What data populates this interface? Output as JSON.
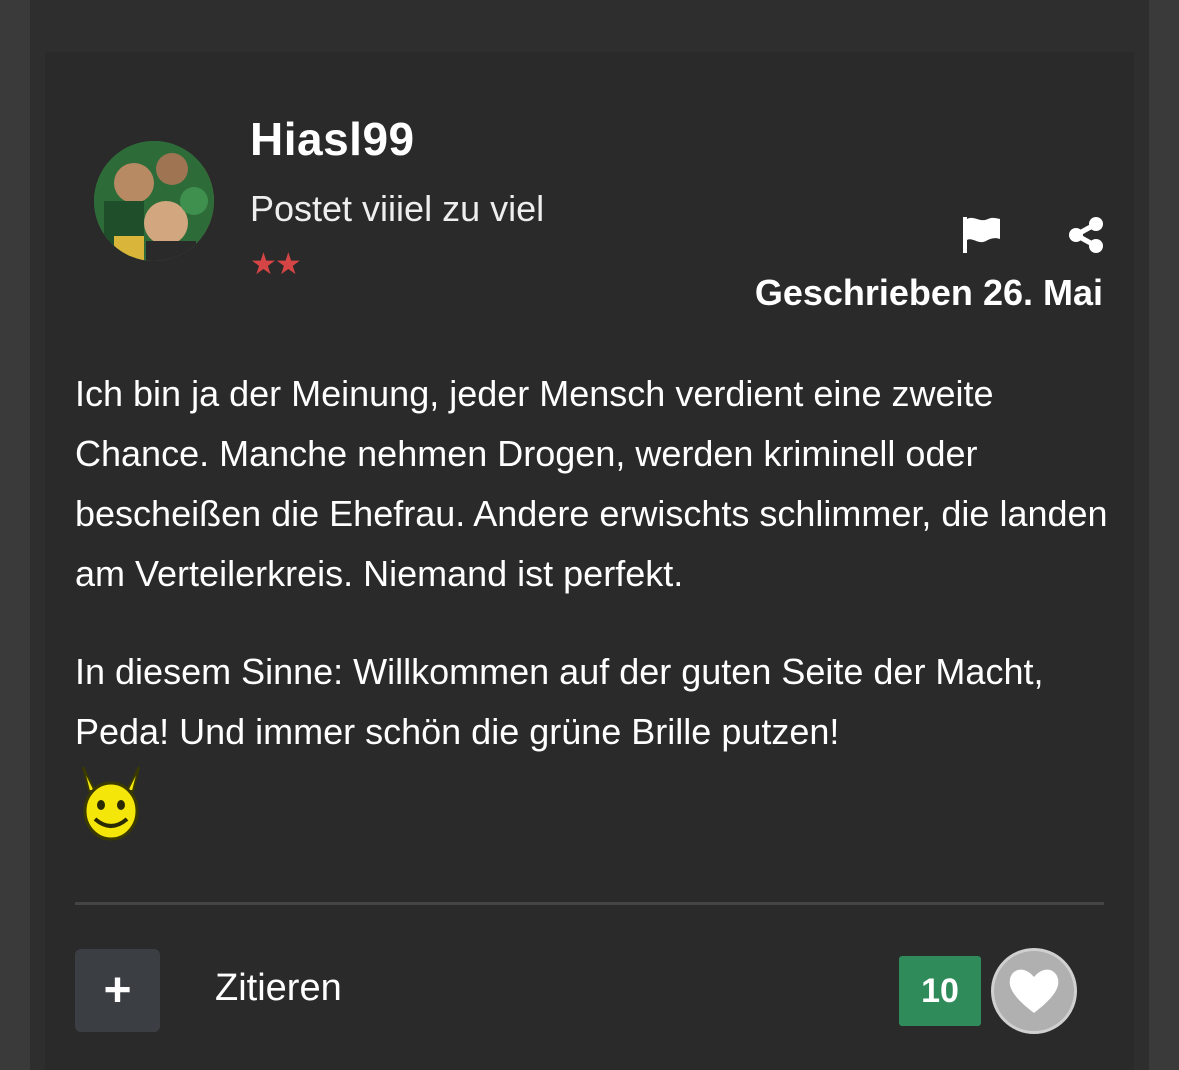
{
  "author": {
    "name": "Hiasl99",
    "title": "Postet viiiel zu viel",
    "rank_stars": "★★"
  },
  "post": {
    "date_prefix": "Geschrieben",
    "date": "26. Mai",
    "paragraphs": [
      "Ich bin ja der Meinung, jeder Mensch verdient eine zweite Chance. Manche nehmen Drogen, werden kriminell oder bescheißen die Ehefrau. Andere erwischts schlimmer, die landen am Verteilerkreis. Niemand ist perfekt.",
      "In diesem Sinne: Willkommen auf der guten Seite der Macht, Peda! Und immer schön die grüne Brille putzen!"
    ],
    "emoji": "horned-smiley-icon"
  },
  "actions": {
    "multiquote_label": "+",
    "quote_label": "Zitieren",
    "reaction_count": "10"
  },
  "icons": {
    "report": "flag-icon",
    "share": "share-icon",
    "like": "heart-icon"
  },
  "colors": {
    "background": "#2a2a2a",
    "reaction_badge": "#2f8c5a",
    "stars": "#d64545",
    "emoji": "#f5e60a"
  }
}
